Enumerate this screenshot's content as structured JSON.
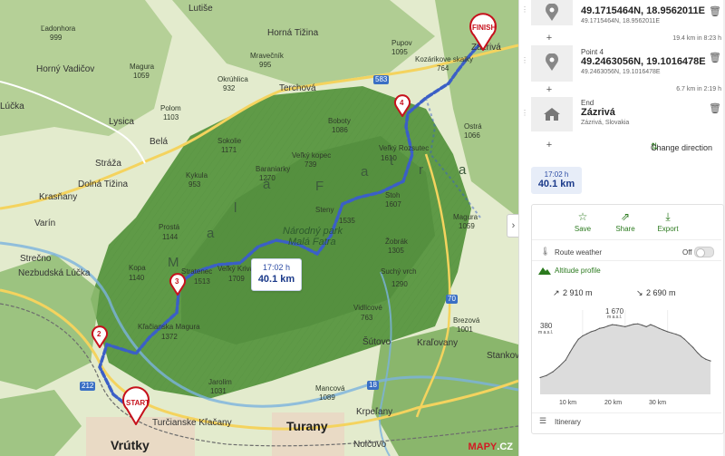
{
  "map": {
    "towns": [
      {
        "id": "vrutky",
        "name": "Vrútky",
        "cls": "bigtown"
      },
      {
        "id": "turany",
        "name": "Turany",
        "cls": "bigtown"
      },
      {
        "id": "zazriva",
        "name": "Zázrivá",
        "cls": "town"
      },
      {
        "id": "terchova",
        "name": "Terchová",
        "cls": "town"
      },
      {
        "id": "bela",
        "name": "Belá",
        "cls": "town"
      },
      {
        "id": "lysica",
        "name": "Lysica",
        "cls": "town"
      },
      {
        "id": "straza",
        "name": "Stráža",
        "cls": "town"
      },
      {
        "id": "dolna-tizina",
        "name": "Dolná Tižina",
        "cls": "town"
      },
      {
        "id": "krasnany",
        "name": "Krasňany",
        "cls": "town"
      },
      {
        "id": "varin",
        "name": "Varín",
        "cls": "town"
      },
      {
        "id": "strecno",
        "name": "Strečno",
        "cls": "town"
      },
      {
        "id": "nezbudska-lucka",
        "name": "Nezbudská Lúčka",
        "cls": "town"
      },
      {
        "id": "sutovo",
        "name": "Šútovo",
        "cls": "town"
      },
      {
        "id": "kralovany",
        "name": "Kraľovany",
        "cls": "town"
      },
      {
        "id": "krpelany",
        "name": "Krpeľany",
        "cls": "town"
      },
      {
        "id": "nolcovo",
        "name": "Nolčovo",
        "cls": "town"
      },
      {
        "id": "turcianske-klacany",
        "name": "Turčianske Kľačany",
        "cls": "town"
      },
      {
        "id": "lucka",
        "name": "Lúčka",
        "cls": "town"
      },
      {
        "id": "horna-tizina",
        "name": "Horná Tižina",
        "cls": "town"
      },
      {
        "id": "horny-vadicov",
        "name": "Horný Vadičov",
        "cls": "town"
      },
      {
        "id": "lutise",
        "name": "Lutiše",
        "cls": "town"
      },
      {
        "id": "stankov",
        "name": "Stankov",
        "cls": "town"
      }
    ],
    "peaks": [
      {
        "id": "p1",
        "name": "Ľadonhora",
        "alt": "999"
      },
      {
        "id": "p2",
        "name": "Magura",
        "alt": "1059"
      },
      {
        "id": "p3",
        "name": "Mravečník",
        "alt": "995"
      },
      {
        "id": "p4",
        "name": "Okrúhlica",
        "alt": "932"
      },
      {
        "id": "p5",
        "name": "Boboty",
        "alt": "1086"
      },
      {
        "id": "p6",
        "name": "Sokolie",
        "alt": "1171"
      },
      {
        "id": "p7",
        "name": "Baraniarky",
        "alt": "1270"
      },
      {
        "id": "p8",
        "name": "Veľký kopec",
        "alt": "739"
      },
      {
        "id": "p9",
        "name": "Stoh",
        "alt": "1607"
      },
      {
        "id": "p10",
        "name": "Steny",
        "alt": "1535"
      },
      {
        "id": "p11",
        "name": "Kykula",
        "alt": "953"
      },
      {
        "id": "p12",
        "name": "Prostá",
        "alt": "1144"
      },
      {
        "id": "p13",
        "name": "Kopa",
        "alt": "1140"
      },
      {
        "id": "p14",
        "name": "Stratenec",
        "alt": "1513"
      },
      {
        "id": "p15",
        "name": "Veľký Kriváň",
        "alt": "1709"
      },
      {
        "id": "p16",
        "name": "Žobrák",
        "alt": "1305"
      },
      {
        "id": "p17",
        "name": "Suchý vrch",
        "alt": "1290"
      },
      {
        "id": "p18",
        "name": "Vidlicové",
        "alt": "763"
      },
      {
        "id": "p19",
        "name": "Kľačianska Magura",
        "alt": "1372"
      },
      {
        "id": "p20",
        "name": "Jarolim",
        "alt": "1031"
      },
      {
        "id": "p21",
        "name": "Mancová",
        "alt": "1089"
      },
      {
        "id": "p22",
        "name": "Brezová",
        "alt": "1001"
      },
      {
        "id": "p23",
        "name": "Ostrá",
        "alt": "1066"
      },
      {
        "id": "p24",
        "name": "Kozárikove skalky",
        "alt": "764"
      },
      {
        "id": "p25",
        "name": "Veľký Rozsutec",
        "alt": "1610"
      },
      {
        "id": "p26",
        "name": "Pupov",
        "alt": "1095"
      },
      {
        "id": "p27",
        "name": "Polom",
        "alt": "1103"
      },
      {
        "id": "p28",
        "name": "Magura",
        "alt": "1059"
      }
    ],
    "park_name_1": "Národný park",
    "park_name_2": "Malá Fatra",
    "range_letters": [
      "M",
      "a",
      "l",
      "á",
      "F",
      "a",
      "t",
      "r",
      "a"
    ],
    "road_numbers": [
      "583",
      "70",
      "18",
      "212"
    ],
    "markers": [
      {
        "id": "start",
        "label": "START"
      },
      {
        "id": "finish",
        "label": "FINISH"
      },
      {
        "id": "m2",
        "label": "2"
      },
      {
        "id": "m3",
        "label": "3"
      },
      {
        "id": "m4",
        "label": "4"
      }
    ],
    "route_box": {
      "time": "17:02 h",
      "distance": "40.1 km"
    },
    "logo": {
      "brand": "MAPY",
      "suffix": ".CZ"
    },
    "collapse_icon": "›"
  },
  "panel": {
    "waypoints": [
      {
        "type": "",
        "main": "49.1715464N, 18.9562011E",
        "sub": "49.1715464N, 18.9562011E",
        "icon": "pin-icon",
        "segment": "19.4 km in 8:23 h"
      },
      {
        "type": "Point 4",
        "main": "49.2463056N, 19.1016478E",
        "sub": "49.2463056N, 19.1016478E",
        "icon": "pin-icon",
        "segment": "6.7 km in 2:19 h"
      },
      {
        "type": "End",
        "main": "Zázrivá",
        "sub": "Zázrivá, Slovakia",
        "icon": "house-icon",
        "segment": ""
      }
    ],
    "change_direction": "Change direction",
    "result": {
      "time": "17:02 h",
      "distance": "40.1 km"
    },
    "actions": [
      {
        "id": "save",
        "label": "Save",
        "icon": "☆"
      },
      {
        "id": "share",
        "label": "Share",
        "icon": "⇗"
      },
      {
        "id": "export",
        "label": "Export",
        "icon": "⤓"
      }
    ],
    "route_weather": "Route weather",
    "weather_toggle": "Off",
    "altitude_profile": "Altitude profile",
    "ascent": "2 910 m",
    "descent": "2 690 m",
    "peak_alt": "1 670",
    "peak_unit": "m a.s.l.",
    "start_alt": "380",
    "start_unit": "m a.s.l.",
    "x_ticks": [
      "10 km",
      "20 km",
      "30 km"
    ],
    "itinerary": "Itinerary"
  },
  "chart_data": {
    "type": "area",
    "title": "Altitude profile",
    "xlabel": "",
    "ylabel": "",
    "x_unit": "km",
    "y_unit": "m a.s.l.",
    "xlim": [
      0,
      40.1
    ],
    "x": [
      0,
      1.5,
      3,
      4.5,
      6,
      7,
      8,
      9,
      10,
      11,
      12,
      13,
      14,
      15,
      16,
      17,
      18,
      19,
      20,
      21,
      22,
      23,
      24,
      25,
      26,
      27,
      28,
      29,
      30,
      31,
      32,
      33,
      34,
      35,
      36,
      37,
      38,
      39,
      40.1
    ],
    "values": [
      380,
      430,
      520,
      650,
      800,
      980,
      1150,
      1300,
      1380,
      1430,
      1480,
      1510,
      1560,
      1580,
      1620,
      1650,
      1640,
      1620,
      1600,
      1630,
      1660,
      1670,
      1640,
      1600,
      1650,
      1610,
      1560,
      1520,
      1480,
      1450,
      1420,
      1380,
      1300,
      1200,
      1100,
      980,
      880,
      820,
      780
    ]
  }
}
